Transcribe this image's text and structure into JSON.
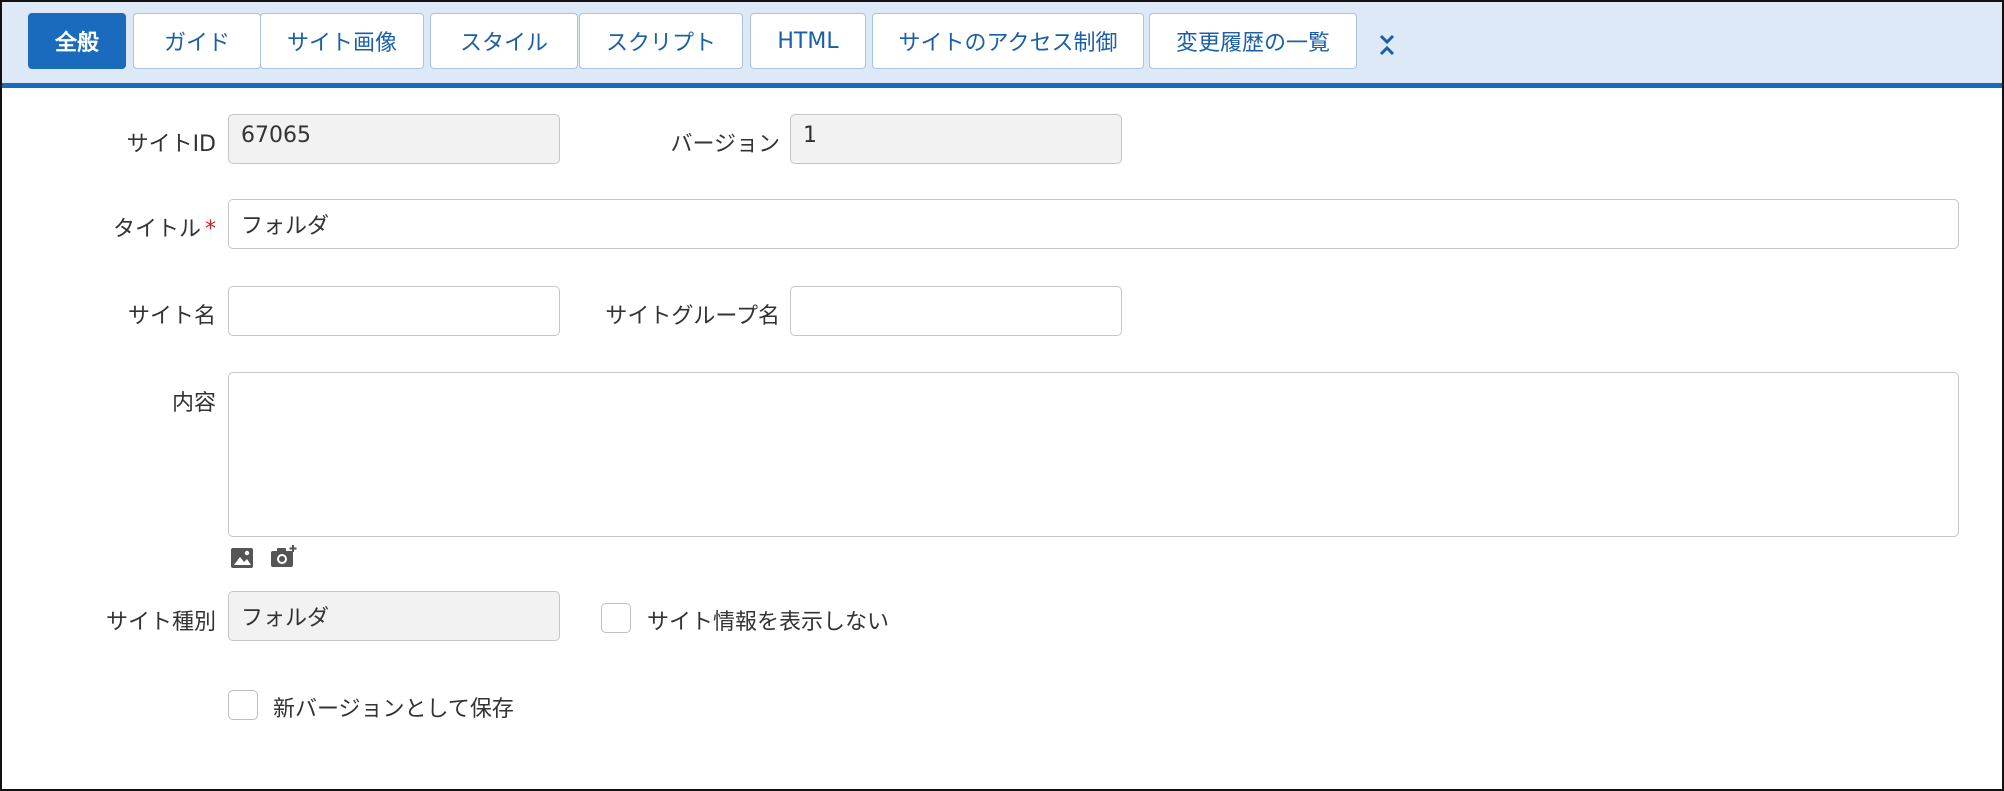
{
  "tabs": [
    {
      "label": "全般",
      "active": true
    },
    {
      "label": "ガイド"
    },
    {
      "label": "サイト画像"
    },
    {
      "label": "スタイル"
    },
    {
      "label": "スクリプト"
    },
    {
      "label": "HTML"
    },
    {
      "label": "サイトのアクセス制御"
    },
    {
      "label": "変更履歴の一覧"
    }
  ],
  "more_icon": "chevron-collapse-expand-icon",
  "fields": {
    "site_id": {
      "label": "サイトID",
      "value": "67065"
    },
    "version": {
      "label": "バージョン",
      "value": "1"
    },
    "title": {
      "label": "タイトル",
      "required_mark": "*",
      "value": "フォルダ"
    },
    "site_name": {
      "label": "サイト名",
      "value": ""
    },
    "site_group_name": {
      "label": "サイトグループ名",
      "value": ""
    },
    "content": {
      "label": "内容",
      "value": ""
    },
    "site_type": {
      "label": "サイト種別",
      "value": "フォルダ"
    }
  },
  "content_toolbar": {
    "image_icon": "image-icon",
    "camera_icon": "camera-add-icon"
  },
  "checkboxes": {
    "hide_site_info": {
      "label": "サイト情報を表示しない",
      "checked": false
    },
    "save_as_new_version": {
      "label": "新バージョンとして保存",
      "checked": false
    }
  },
  "colors": {
    "accent": "#1a6bbd",
    "tabbar_bg": "#dde9f6",
    "required": "#d21f1f",
    "readonly_bg": "#f2f2f2"
  }
}
